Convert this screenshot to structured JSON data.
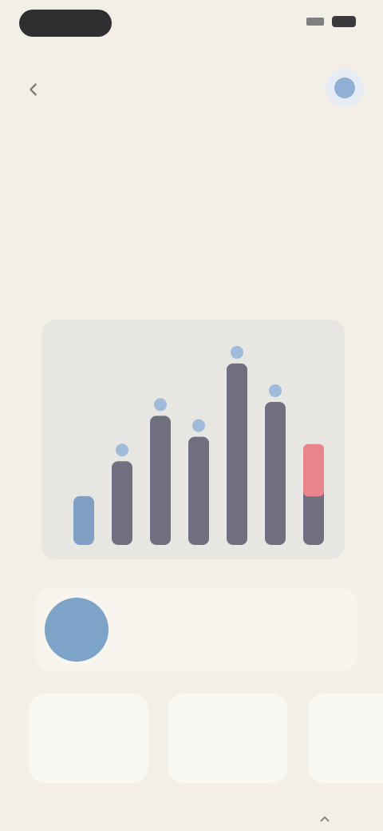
{
  "status_bar": {
    "pill_icon": "dynamic-island",
    "signal_icon": "signal-icon",
    "battery_icon": "battery-icon"
  },
  "header": {
    "back_icon": "back-arrow-icon",
    "avatar_icon": "avatar-icon"
  },
  "page": {
    "title": "",
    "subtitle": ""
  },
  "chart_data": {
    "type": "bar",
    "categories": [
      "",
      "",
      "",
      "",
      "",
      "",
      ""
    ],
    "series": [
      {
        "values": [
          14,
          24,
          37,
          31,
          52,
          41,
          28
        ]
      }
    ],
    "highlight": {
      "index": 6,
      "extra": 15,
      "color": "#e8848a"
    },
    "bar_color": "#6f6f80",
    "first_bar_color": "#7fa0c2",
    "marker_color": "#9fbbd8",
    "ylim": [
      0,
      60
    ],
    "grid": false
  },
  "summary": {
    "label": "",
    "text": "",
    "circle_color": "#7ea3c8"
  },
  "tiles": [
    {
      "label": "",
      "value": ""
    },
    {
      "label": "",
      "value": ""
    },
    {
      "label": "",
      "value": ""
    }
  ],
  "bottom": {
    "label": "",
    "icon": "chevron-icon"
  }
}
